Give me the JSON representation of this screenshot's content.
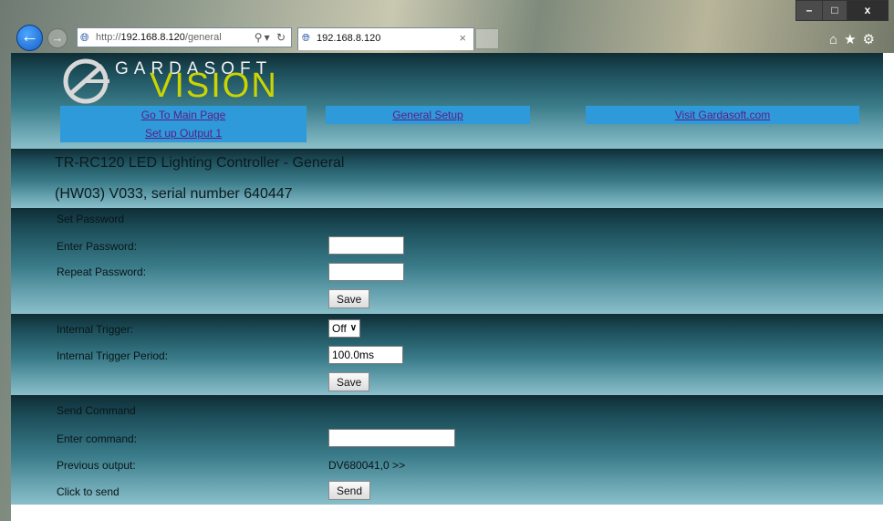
{
  "browser": {
    "address_prefix": "http://",
    "address_host": "192.168.8.120",
    "address_path": "/general.cg",
    "tab_title": "192.168.8.120"
  },
  "logo": {
    "top": "GARDASOFT",
    "bottom": "VISION"
  },
  "nav": {
    "main": "Go To Main Page",
    "output": "Set up Output 1",
    "general": "General Setup",
    "visit": "Visit Gardasoft.com"
  },
  "title": {
    "line1": "TR-RC120 LED Lighting Controller - General",
    "line2": "(HW03) V033, serial number 640447"
  },
  "password": {
    "heading": "Set Password",
    "enter_label": "Enter Password:",
    "repeat_label": "Repeat Password:",
    "save": "Save"
  },
  "trigger": {
    "internal_label": "Internal Trigger:",
    "internal_value": "Off",
    "period_label": "Internal Trigger Period:",
    "period_value": "100.0ms",
    "save": "Save"
  },
  "command": {
    "heading": "Send Command",
    "enter_label": "Enter command:",
    "previous_label": "Previous output:",
    "previous_value": "DV680041,0 >>",
    "click_label": "Click to send",
    "send": "Send"
  },
  "icons": [
    "back-arrow-icon",
    "forward-arrow-icon",
    "globe-icon",
    "search-icon",
    "refresh-icon",
    "close-icon",
    "home-icon",
    "star-icon",
    "gear-icon"
  ]
}
